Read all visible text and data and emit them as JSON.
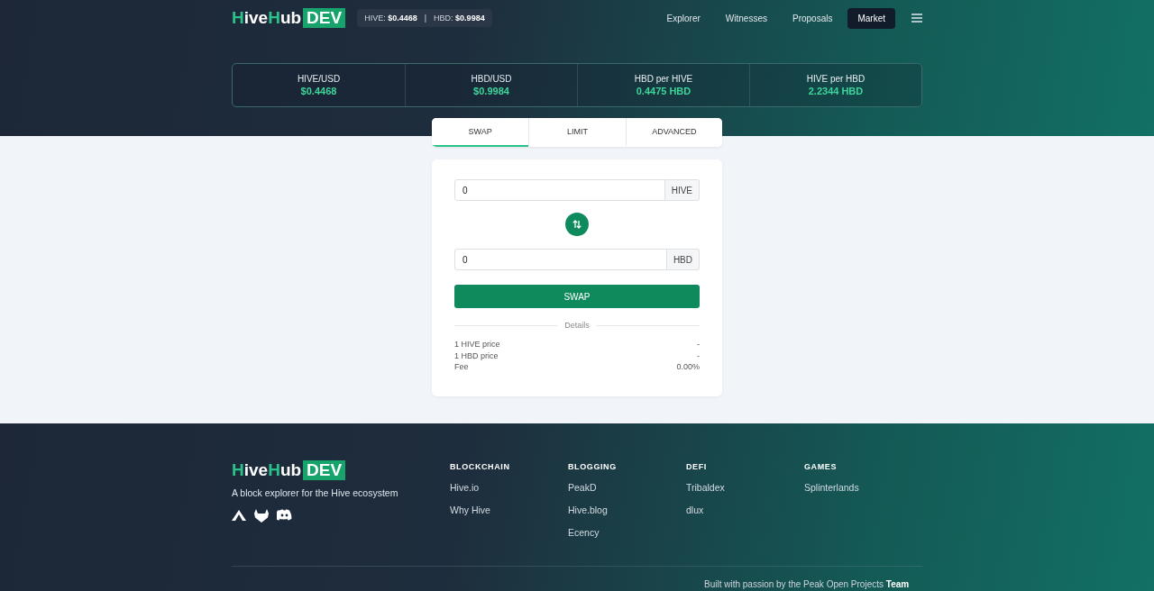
{
  "header": {
    "logo": [
      {
        "text": "H",
        "accent": true
      },
      {
        "text": "ive",
        "accent": false
      },
      {
        "text": "H",
        "accent": true
      },
      {
        "text": "ub",
        "accent": false
      }
    ],
    "logo_badge": "DEV",
    "ticker": [
      {
        "label": "HIVE:",
        "value": "$0.4468"
      },
      {
        "label": "HBD:",
        "value": "$0.9984"
      }
    ],
    "ticker_separator": "|",
    "nav": [
      {
        "label": "Explorer",
        "selected": false
      },
      {
        "label": "Witnesses",
        "selected": false
      },
      {
        "label": "Proposals",
        "selected": false
      },
      {
        "label": "Market",
        "selected": true
      }
    ]
  },
  "stats": [
    {
      "label": "HIVE/USD",
      "value": "$0.4468"
    },
    {
      "label": "HBD/USD",
      "value": "$0.9984"
    },
    {
      "label": "HBD per HIVE",
      "value": "0.4475 HBD"
    },
    {
      "label": "HIVE per HBD",
      "value": "2.2344 HBD"
    }
  ],
  "tabs": [
    {
      "label": "SWAP",
      "selected": true
    },
    {
      "label": "LIMIT",
      "selected": false
    },
    {
      "label": "ADVANCED",
      "selected": false
    }
  ],
  "swap": {
    "from": {
      "value": "0",
      "unit": "HIVE"
    },
    "to": {
      "value": "0",
      "unit": "HBD"
    },
    "button": "SWAP",
    "details_title": "Details",
    "details": [
      {
        "label": "1 HIVE price",
        "value": "-"
      },
      {
        "label": "1 HBD price",
        "value": "-"
      },
      {
        "label": "Fee",
        "value": "0.00%"
      }
    ]
  },
  "footer": {
    "logo": [
      {
        "text": "H",
        "accent": true
      },
      {
        "text": "ive",
        "accent": false
      },
      {
        "text": "H",
        "accent": true
      },
      {
        "text": "ub",
        "accent": false
      }
    ],
    "logo_badge": "DEV",
    "tagline": "A block explorer for the Hive ecosystem",
    "columns": [
      {
        "title": "BLOCKCHAIN",
        "links": [
          "Hive.io",
          "Why Hive"
        ]
      },
      {
        "title": "BLOGGING",
        "links": [
          "PeakD",
          "Hive.blog",
          "Ecency"
        ]
      },
      {
        "title": "DEFI",
        "links": [
          "Tribaldex",
          "dlux"
        ]
      },
      {
        "title": "GAMES",
        "links": [
          "Splinterlands"
        ]
      }
    ],
    "credit": "Built with passion by the Peak Open Projects **Team**"
  }
}
